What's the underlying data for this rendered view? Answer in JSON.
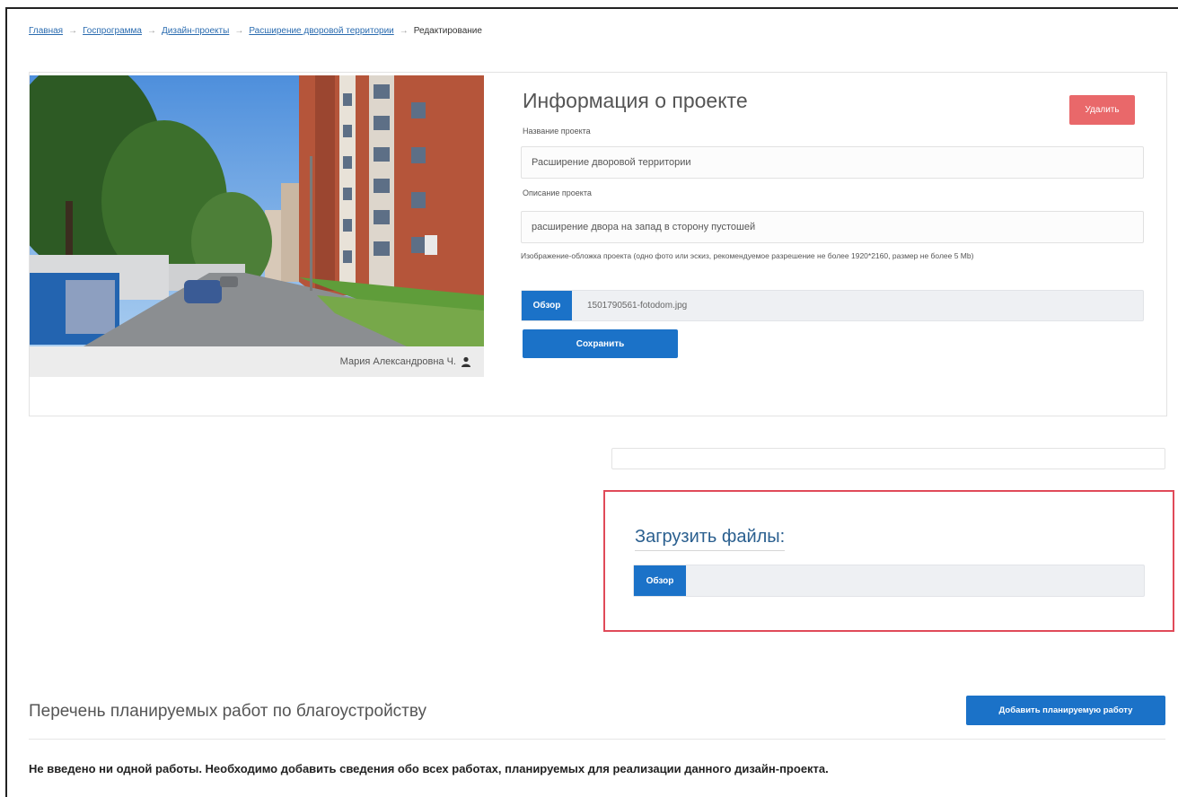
{
  "breadcrumb": {
    "items": [
      "Главная",
      "Госпрограмма",
      "Дизайн-проекты",
      "Расширение дворовой территории"
    ],
    "separator": "→",
    "current": "Редактирование"
  },
  "project_info": {
    "title": "Информация о проекте",
    "delete_label": "Удалить",
    "name_label": "Название проекта",
    "name_value": "Расширение дворовой территории",
    "description_label": "Описание проекта",
    "description_value": "расширение двора на запад в сторону пустошей",
    "image_hint": "Изображение-обложка проекта (одно фото или эскиз, рекомендуемое разрешение не более 1920*2160, размер не более 5 Mb)",
    "browse_label": "Обзор",
    "file_name": "1501790561-fotodom.jpg",
    "save_label": "Сохранить"
  },
  "photo": {
    "author": "Мария Александровна Ч."
  },
  "upload": {
    "title": "Загрузить файлы:",
    "browse_label": "Обзор"
  },
  "works": {
    "title": "Перечень планируемых работ по благоустройству",
    "add_label": "Добавить планируемую работу",
    "empty_message": "Не введено ни одной работы. Необходимо добавить сведения обо всех работах, планируемых для реализации данного дизайн-проекта."
  },
  "colors": {
    "primary": "#1b72c8",
    "danger": "#e9686a",
    "highlight_border": "#e04a59"
  },
  "icons": {
    "author": "user-icon"
  }
}
